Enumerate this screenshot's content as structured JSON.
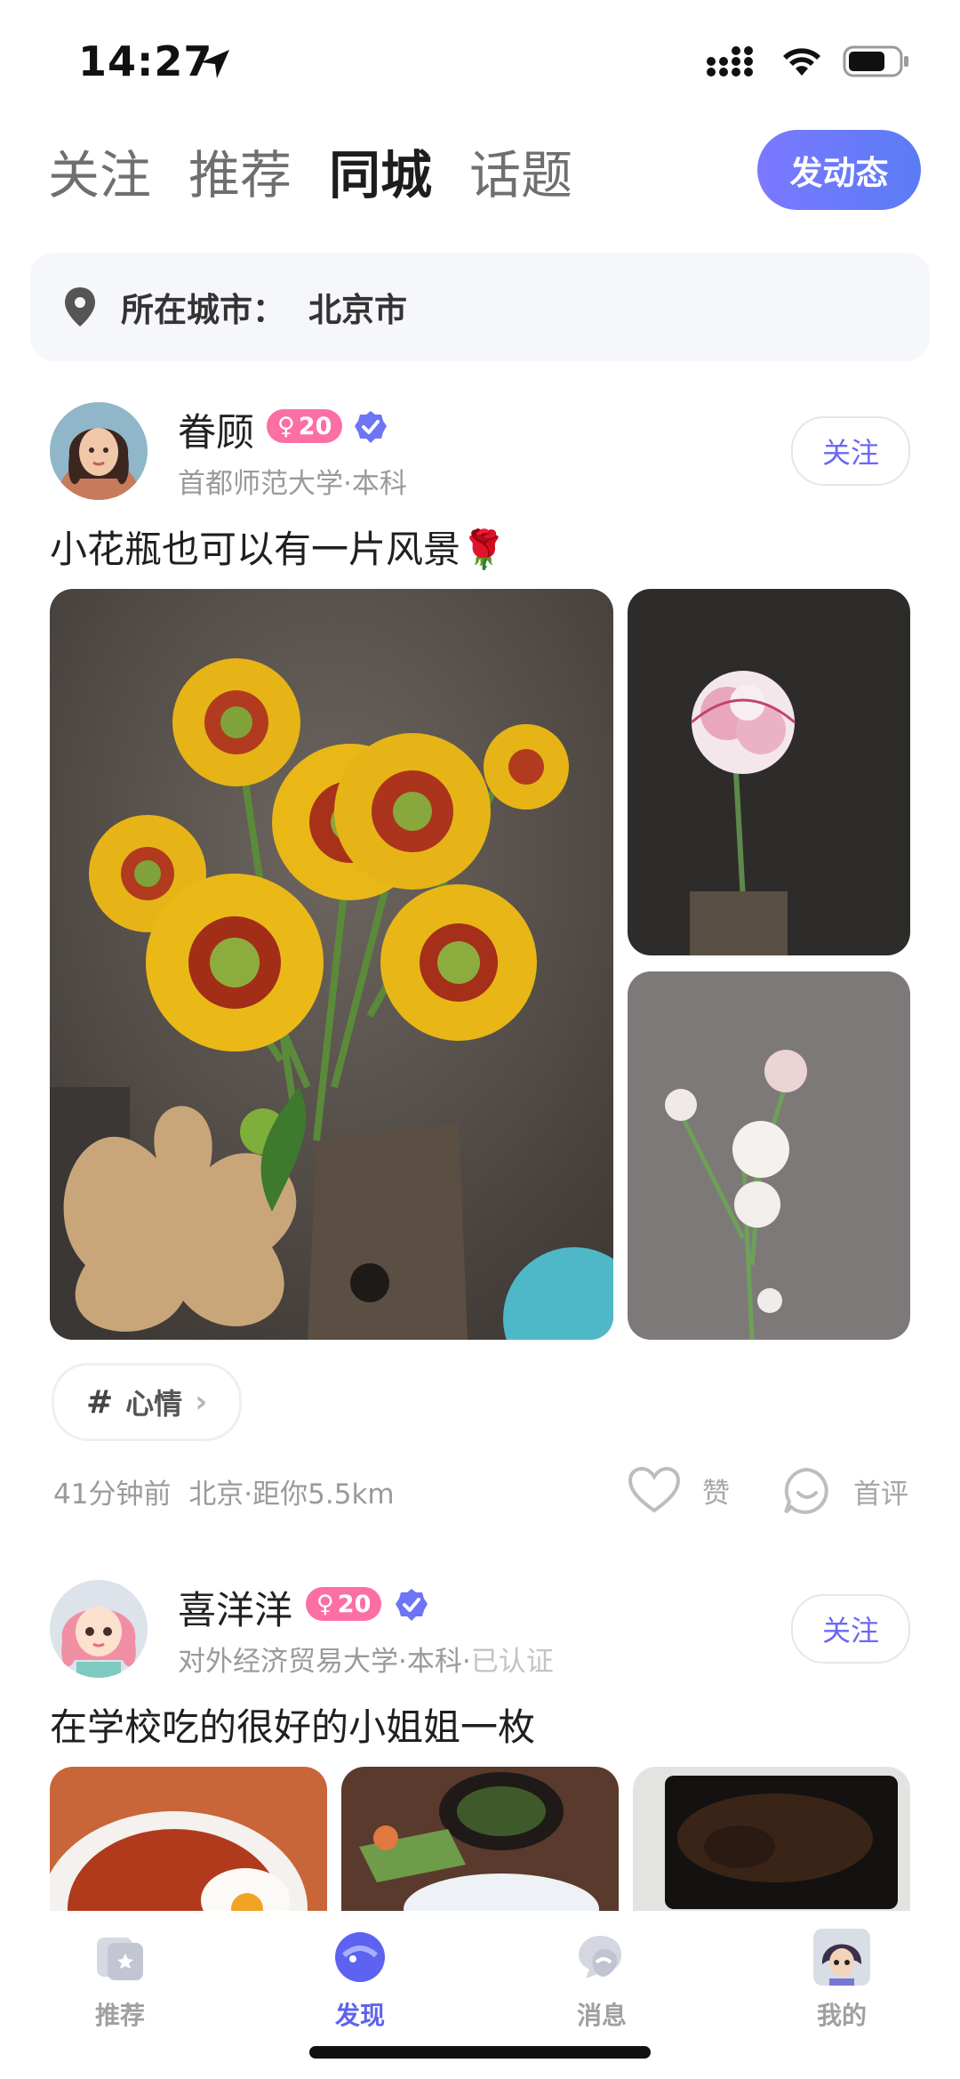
{
  "status_bar": {
    "time": "14:27"
  },
  "tabs": [
    {
      "label": "关注",
      "active": false
    },
    {
      "label": "推荐",
      "active": false
    },
    {
      "label": "同城",
      "active": true
    },
    {
      "label": "话题",
      "active": false
    }
  ],
  "post_button": "发动态",
  "city": {
    "label": "所在城市：",
    "value": "北京市"
  },
  "posts": [
    {
      "username": "眷顾",
      "gender": "♀",
      "age": "20",
      "school": "首都师范大学·本科",
      "follow_label": "关注",
      "text": "小花瓶也可以有一片风景🌹",
      "topic": "心情",
      "time": "41分钟前",
      "location": "北京·距你5.5km",
      "like_label": "赞",
      "comment_label": "首评"
    },
    {
      "username": "喜洋洋",
      "gender": "♀",
      "age": "20",
      "school": "对外经济贸易大学·本科·",
      "verified_text": "已认证",
      "follow_label": "关注",
      "text": "在学校吃的很好的小姐姐一枚"
    }
  ],
  "bottom_nav": [
    {
      "label": "推荐",
      "icon": "recommend-icon",
      "active": false
    },
    {
      "label": "发现",
      "icon": "discover-icon",
      "active": true
    },
    {
      "label": "消息",
      "icon": "message-icon",
      "active": false
    },
    {
      "label": "我的",
      "icon": "profile-avatar-icon",
      "active": false
    }
  ],
  "colors": {
    "accent": "#5d63f0",
    "female_badge": "#fb6fa4",
    "verified": "#6d74f5"
  }
}
